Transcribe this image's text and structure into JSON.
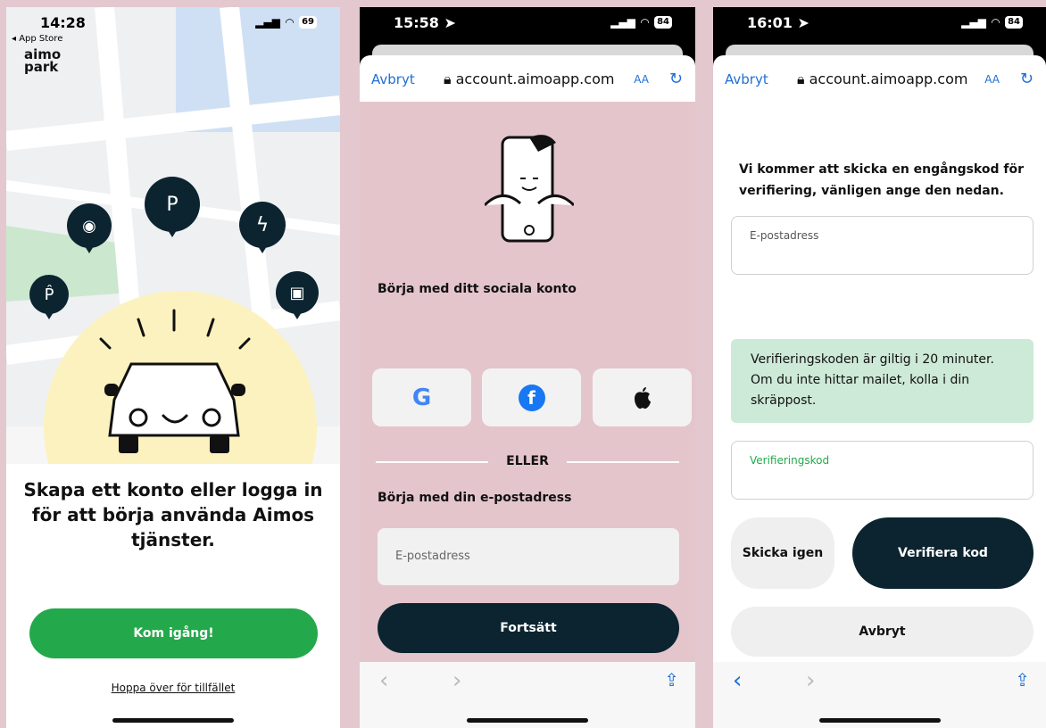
{
  "phone1": {
    "status": {
      "time": "14:28",
      "back_app": "◂ App Store",
      "battery": "69"
    },
    "logo": {
      "line1": "aimo",
      "line2": "park"
    },
    "headline": "Skapa ett konto eller logga in för att börja använda Aimos tjänster.",
    "primary_button": "Kom igång!",
    "skip_link": "Hoppa över för tillfället"
  },
  "phone2": {
    "status": {
      "time": "15:58",
      "battery": "84"
    },
    "urlbar": {
      "cancel": "Avbryt",
      "url": "account.aimoapp.com",
      "text_size": "AA"
    },
    "social_heading": "Börja med ditt sociala konto",
    "social_buttons": [
      {
        "label": "G"
      },
      {
        "label": "f"
      },
      {
        "label": ""
      }
    ],
    "divider": "ELLER",
    "email_heading": "Börja med din e-postadress",
    "email_placeholder": "E-postadress",
    "continue_button": "Fortsätt"
  },
  "phone3": {
    "status": {
      "time": "16:01",
      "battery": "84"
    },
    "urlbar": {
      "cancel": "Avbryt",
      "url": "account.aimoapp.com",
      "text_size": "AA"
    },
    "intro": "Vi kommer att skicka en engångskod för verifiering, vänligen ange den nedan.",
    "email_label": "E-postadress",
    "notice": "Verifieringskoden är giltig i 20 minuter. Om du inte hittar mailet, kolla i din skräppost.",
    "code_label": "Verifieringskod",
    "resend_button": "Skicka igen",
    "verify_button": "Verifiera kod",
    "cancel_button": "Avbryt"
  },
  "colors": {
    "green": "#23a94b",
    "navy": "#0b2430",
    "pink": "#e4c5cc",
    "link_blue": "#1f6fd6",
    "notice_green": "#cde9d7"
  }
}
